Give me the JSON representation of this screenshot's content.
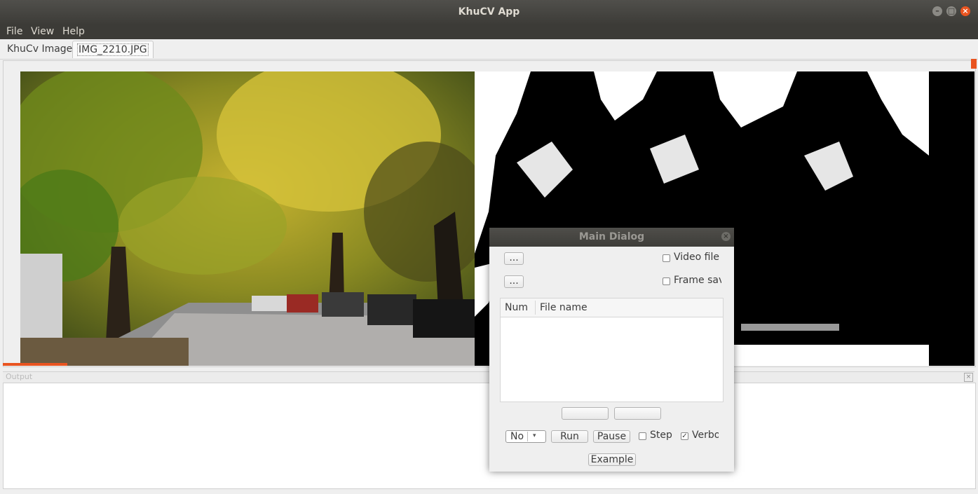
{
  "window": {
    "title": "KhuCV App"
  },
  "menu": [
    "File",
    "View",
    "Help"
  ],
  "tabs": [
    "KhuCv Image",
    "IMG_2210.JPG"
  ],
  "output": {
    "title": "Output"
  },
  "dialog": {
    "title": "Main Dialog",
    "browse1": "...",
    "browse2": "...",
    "video_file": "Video file",
    "frame_save": "Frame sav",
    "col_num": "Num",
    "col_file": "File name",
    "combo_value": "No",
    "run": "Run",
    "pause": "Pause",
    "step": "Step",
    "verbose": "Verbo",
    "example": "Example",
    "step_checked": false,
    "verbose_checked": true
  },
  "colors": {
    "accent": "#e95420",
    "titlebar": "#3c3b37"
  }
}
